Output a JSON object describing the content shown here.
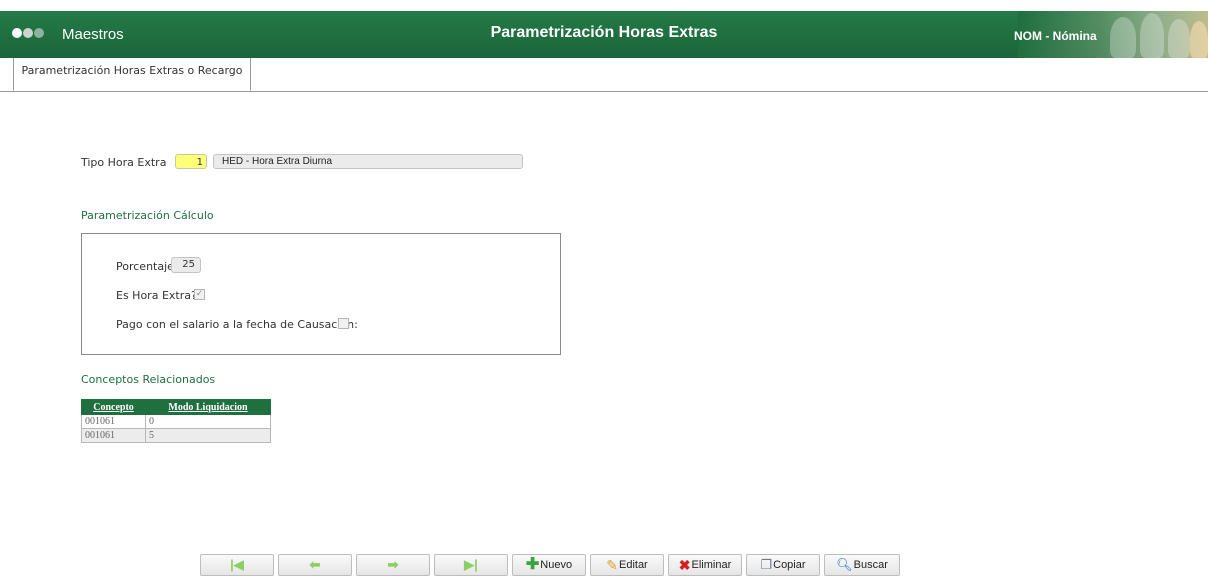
{
  "header": {
    "module": "Maestros",
    "title": "Parametrización Horas Extras",
    "app": "NOM - Nómina",
    "dot_colors": [
      "#ffffff",
      "#c9d6cd",
      "#8fb39a"
    ],
    "bg_color": "#1f6f3f"
  },
  "tabs": [
    {
      "label": "Parametrización Horas Extras o Recargo",
      "active": true
    }
  ],
  "form": {
    "tipo_label": "Tipo Hora Extra",
    "tipo_code": "1",
    "tipo_desc": "HED - Hora Extra Diurna"
  },
  "calc": {
    "section_title": "Parametrización Cálculo",
    "porcentaje_label": "Porcentaje:",
    "porcentaje_value": "25",
    "es_hora_extra_label": "Es Hora Extra?:",
    "es_hora_extra_checked": true,
    "pago_label": "Pago con el salario a la fecha de Causación:",
    "pago_checked": false
  },
  "conceptos": {
    "section_title": "Conceptos Relacionados",
    "columns": [
      "Concepto",
      "Modo Liquidacion"
    ],
    "rows": [
      [
        "001061",
        "0"
      ],
      [
        "001061",
        "5"
      ]
    ]
  },
  "toolbar": {
    "first_icon": "first-record-icon",
    "prev_icon": "previous-record-icon",
    "next_icon": "next-record-icon",
    "last_icon": "last-record-icon",
    "nuevo": "Nuevo",
    "editar": "Editar",
    "eliminar": "Eliminar",
    "copiar": "Copiar",
    "buscar": "Buscar"
  }
}
